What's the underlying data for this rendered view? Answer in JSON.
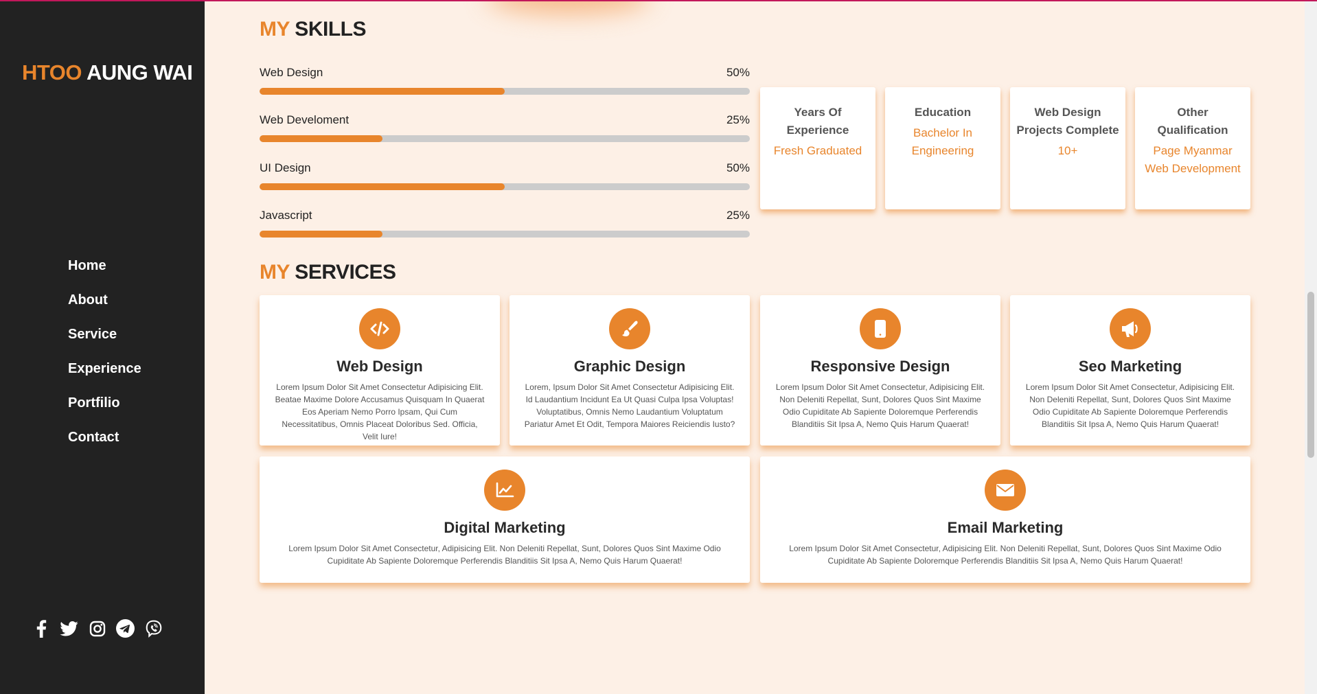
{
  "sidebar": {
    "logo": {
      "first": "HTOO",
      "rest": " AUNG WAI"
    },
    "nav": [
      "Home",
      "About",
      "Service",
      "Experience",
      "Portfilio",
      "Contact"
    ],
    "social": [
      "facebook-icon",
      "twitter-icon",
      "instagram-icon",
      "telegram-icon",
      "viber-icon"
    ]
  },
  "skills": {
    "title_accent": "MY",
    "title_rest": " SKILLS",
    "items": [
      {
        "name": "Web Design",
        "percent_label": "50%",
        "level": 0.5
      },
      {
        "name": "Web Develoment",
        "percent_label": "25%",
        "level": 0.25
      },
      {
        "name": "UI Design",
        "percent_label": "50%",
        "level": 0.5
      },
      {
        "name": "Javascript",
        "percent_label": "25%",
        "level": 0.25
      }
    ]
  },
  "info_cards": [
    {
      "label": "Years Of Experience",
      "value": "Fresh Graduated"
    },
    {
      "label": "Education",
      "value": "Bachelor In Engineering"
    },
    {
      "label": "Web Design Projects Complete",
      "value": "10+"
    },
    {
      "label": "Other Qualification",
      "value": "Page Myanmar Web Development"
    }
  ],
  "services": {
    "title_accent": "MY",
    "title_rest": " SERVICES",
    "items": [
      {
        "icon": "code-icon",
        "title": "Web Design",
        "text": "Lorem Ipsum Dolor Sit Amet Consectetur Adipisicing Elit. Beatae Maxime Dolore Accusamus Quisquam In Quaerat Eos Aperiam Nemo Porro Ipsam, Qui Cum Necessitatibus, Omnis Placeat Doloribus Sed. Officia, Velit Iure!"
      },
      {
        "icon": "paintbrush-icon",
        "title": "Graphic Design",
        "text": "Lorem, Ipsum Dolor Sit Amet Consectetur Adipisicing Elit. Id Laudantium Incidunt Ea Ut Quasi Culpa Ipsa Voluptas! Voluptatibus, Omnis Nemo Laudantium Voluptatum Pariatur Amet Et Odit, Tempora Maiores Reiciendis Iusto?"
      },
      {
        "icon": "mobile-icon",
        "title": "Responsive Design",
        "text": "Lorem Ipsum Dolor Sit Amet Consectetur, Adipisicing Elit. Non Deleniti Repellat, Sunt, Dolores Quos Sint Maxime Odio Cupiditate Ab Sapiente Doloremque Perferendis Blanditiis Sit Ipsa A, Nemo Quis Harum Quaerat!"
      },
      {
        "icon": "megaphone-icon",
        "title": "Seo Marketing",
        "text": "Lorem Ipsum Dolor Sit Amet Consectetur, Adipisicing Elit. Non Deleniti Repellat, Sunt, Dolores Quos Sint Maxime Odio Cupiditate Ab Sapiente Doloremque Perferendis Blanditiis Sit Ipsa A, Nemo Quis Harum Quaerat!"
      },
      {
        "icon": "chart-line-icon",
        "title": "Digital Marketing",
        "text": "Lorem Ipsum Dolor Sit Amet Consectetur, Adipisicing Elit. Non Deleniti Repellat, Sunt, Dolores Quos Sint Maxime Odio Cupiditate Ab Sapiente Doloremque Perferendis Blanditiis Sit Ipsa A, Nemo Quis Harum Quaerat!"
      },
      {
        "icon": "envelope-icon",
        "title": "Email Marketing",
        "text": "Lorem Ipsum Dolor Sit Amet Consectetur, Adipisicing Elit. Non Deleniti Repellat, Sunt, Dolores Quos Sint Maxime Odio Cupiditate Ab Sapiente Doloremque Perferendis Blanditiis Sit Ipsa A, Nemo Quis Harum Quaerat!"
      }
    ]
  },
  "colors": {
    "accent": "#e8852c",
    "sidebar": "#222222",
    "background": "#fdf0e6"
  }
}
